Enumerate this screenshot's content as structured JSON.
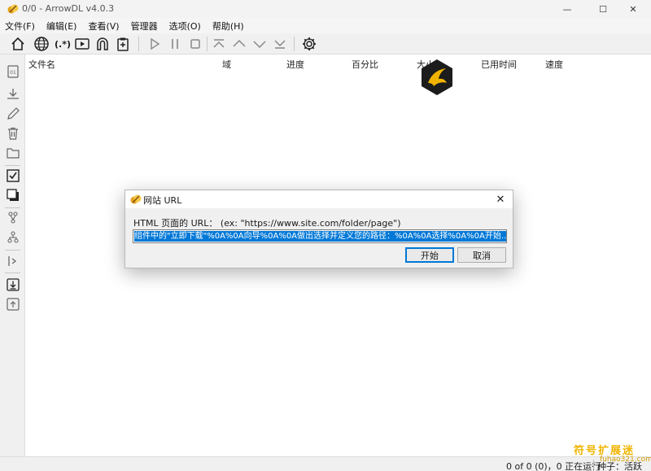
{
  "window": {
    "title": "0/0 - ArrowDL v4.0.3",
    "min_glyph": "—",
    "max_glyph": "☐",
    "close_glyph": "✕"
  },
  "menu": [
    "文件(F)",
    "编辑(E)",
    "查看(V)",
    "管理器",
    "选项(O)",
    "帮助(H)"
  ],
  "toolbar": {
    "icons": [
      "home-icon",
      "globe-icon",
      "regex-icon",
      "video-icon",
      "magnet-icon",
      "clipboard-icon",
      "play-icon",
      "pause-icon",
      "stop-icon",
      "move-top-icon",
      "move-up-icon",
      "move-down-icon",
      "move-bottom-icon",
      "settings-icon"
    ],
    "regex_glyph": "(.*)"
  },
  "sidebar": {
    "icons": [
      "info-icon",
      "download-icon",
      "edit-icon",
      "trash-icon",
      "folder-icon",
      "check-all-icon",
      "select-invert-icon",
      "tree-expand-icon",
      "tree-collapse-icon",
      "open-folder-icon",
      "import-icon",
      "export-icon"
    ]
  },
  "table": {
    "columns": [
      "文件名",
      "域",
      "进度",
      "百分比",
      "大小",
      "已用时间",
      "速度"
    ]
  },
  "status": {
    "summary": "0 of 0 (0)，0 正在运行",
    "seed": "种子：活跃"
  },
  "dialog": {
    "title": "网站 URL",
    "label": "HTML 页面的 URL：  (ex: \"https://www.site.com/folder/page\")",
    "input_value": "组件中的\"立即下载\"%0A%0A向导%0A%0A做出选择并定义您的路径：%0A%0A选择%0A%0A开始……黑!",
    "start_label": "开始",
    "cancel_label": "取消",
    "close_glyph": "✕"
  },
  "watermark": {
    "line1": "符号扩展迷",
    "line2": "fuhao321.com"
  },
  "colors": {
    "accent": "#0078d7",
    "watermark": "#f0b400"
  }
}
